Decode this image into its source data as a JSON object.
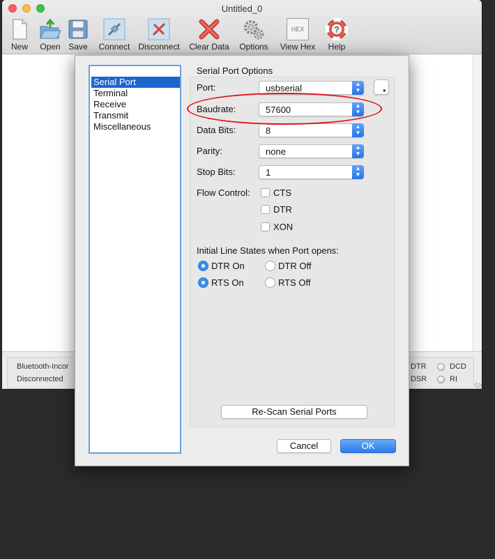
{
  "window": {
    "title": "Untitled_0"
  },
  "toolbar": {
    "items": [
      {
        "label": "New",
        "icon": "new-document-icon"
      },
      {
        "label": "Open",
        "icon": "open-folder-icon"
      },
      {
        "label": "Save",
        "icon": "save-floppy-icon"
      },
      {
        "label": "Connect",
        "icon": "connect-plug-icon"
      },
      {
        "label": "Disconnect",
        "icon": "disconnect-plug-icon"
      },
      {
        "label": "Clear Data",
        "icon": "clear-x-icon"
      },
      {
        "label": "Options",
        "icon": "gears-icon"
      },
      {
        "label": "View Hex",
        "icon": "hex-icon",
        "icon_text": "HEX"
      },
      {
        "label": "Help",
        "icon": "lifebuoy-icon"
      }
    ]
  },
  "status": {
    "port_name": "Bluetooth-Incor",
    "connection": "Disconnected",
    "indicators": [
      "DTR",
      "DCD",
      "DSR",
      "RI"
    ]
  },
  "dialog": {
    "categories": [
      "Serial Port",
      "Terminal",
      "Receive",
      "Transmit",
      "Miscellaneous"
    ],
    "selected_category": "Serial Port",
    "section_title": "Serial Port Options",
    "port": {
      "label": "Port:",
      "value": "usbserial"
    },
    "baudrate": {
      "label": "Baudrate:",
      "value": "57600"
    },
    "data_bits": {
      "label": "Data Bits:",
      "value": "8"
    },
    "parity": {
      "label": "Parity:",
      "value": "none"
    },
    "stop_bits": {
      "label": "Stop Bits:",
      "value": "1"
    },
    "flow_control": {
      "label": "Flow Control:",
      "options": [
        {
          "label": "CTS",
          "checked": false
        },
        {
          "label": "DTR",
          "checked": false
        },
        {
          "label": "XON",
          "checked": false
        }
      ]
    },
    "line_states": {
      "title": "Initial Line States when Port opens:",
      "dtr_on": "DTR On",
      "dtr_off": "DTR Off",
      "rts_on": "RTS On",
      "rts_off": "RTS Off",
      "dtr_selected": "DTR On",
      "rts_selected": "RTS On"
    },
    "rescan_button": "Re-Scan Serial Ports",
    "cancel_button": "Cancel",
    "ok_button": "OK",
    "accent_color": "#2a74e8",
    "highlight_color": "#e0141b"
  }
}
